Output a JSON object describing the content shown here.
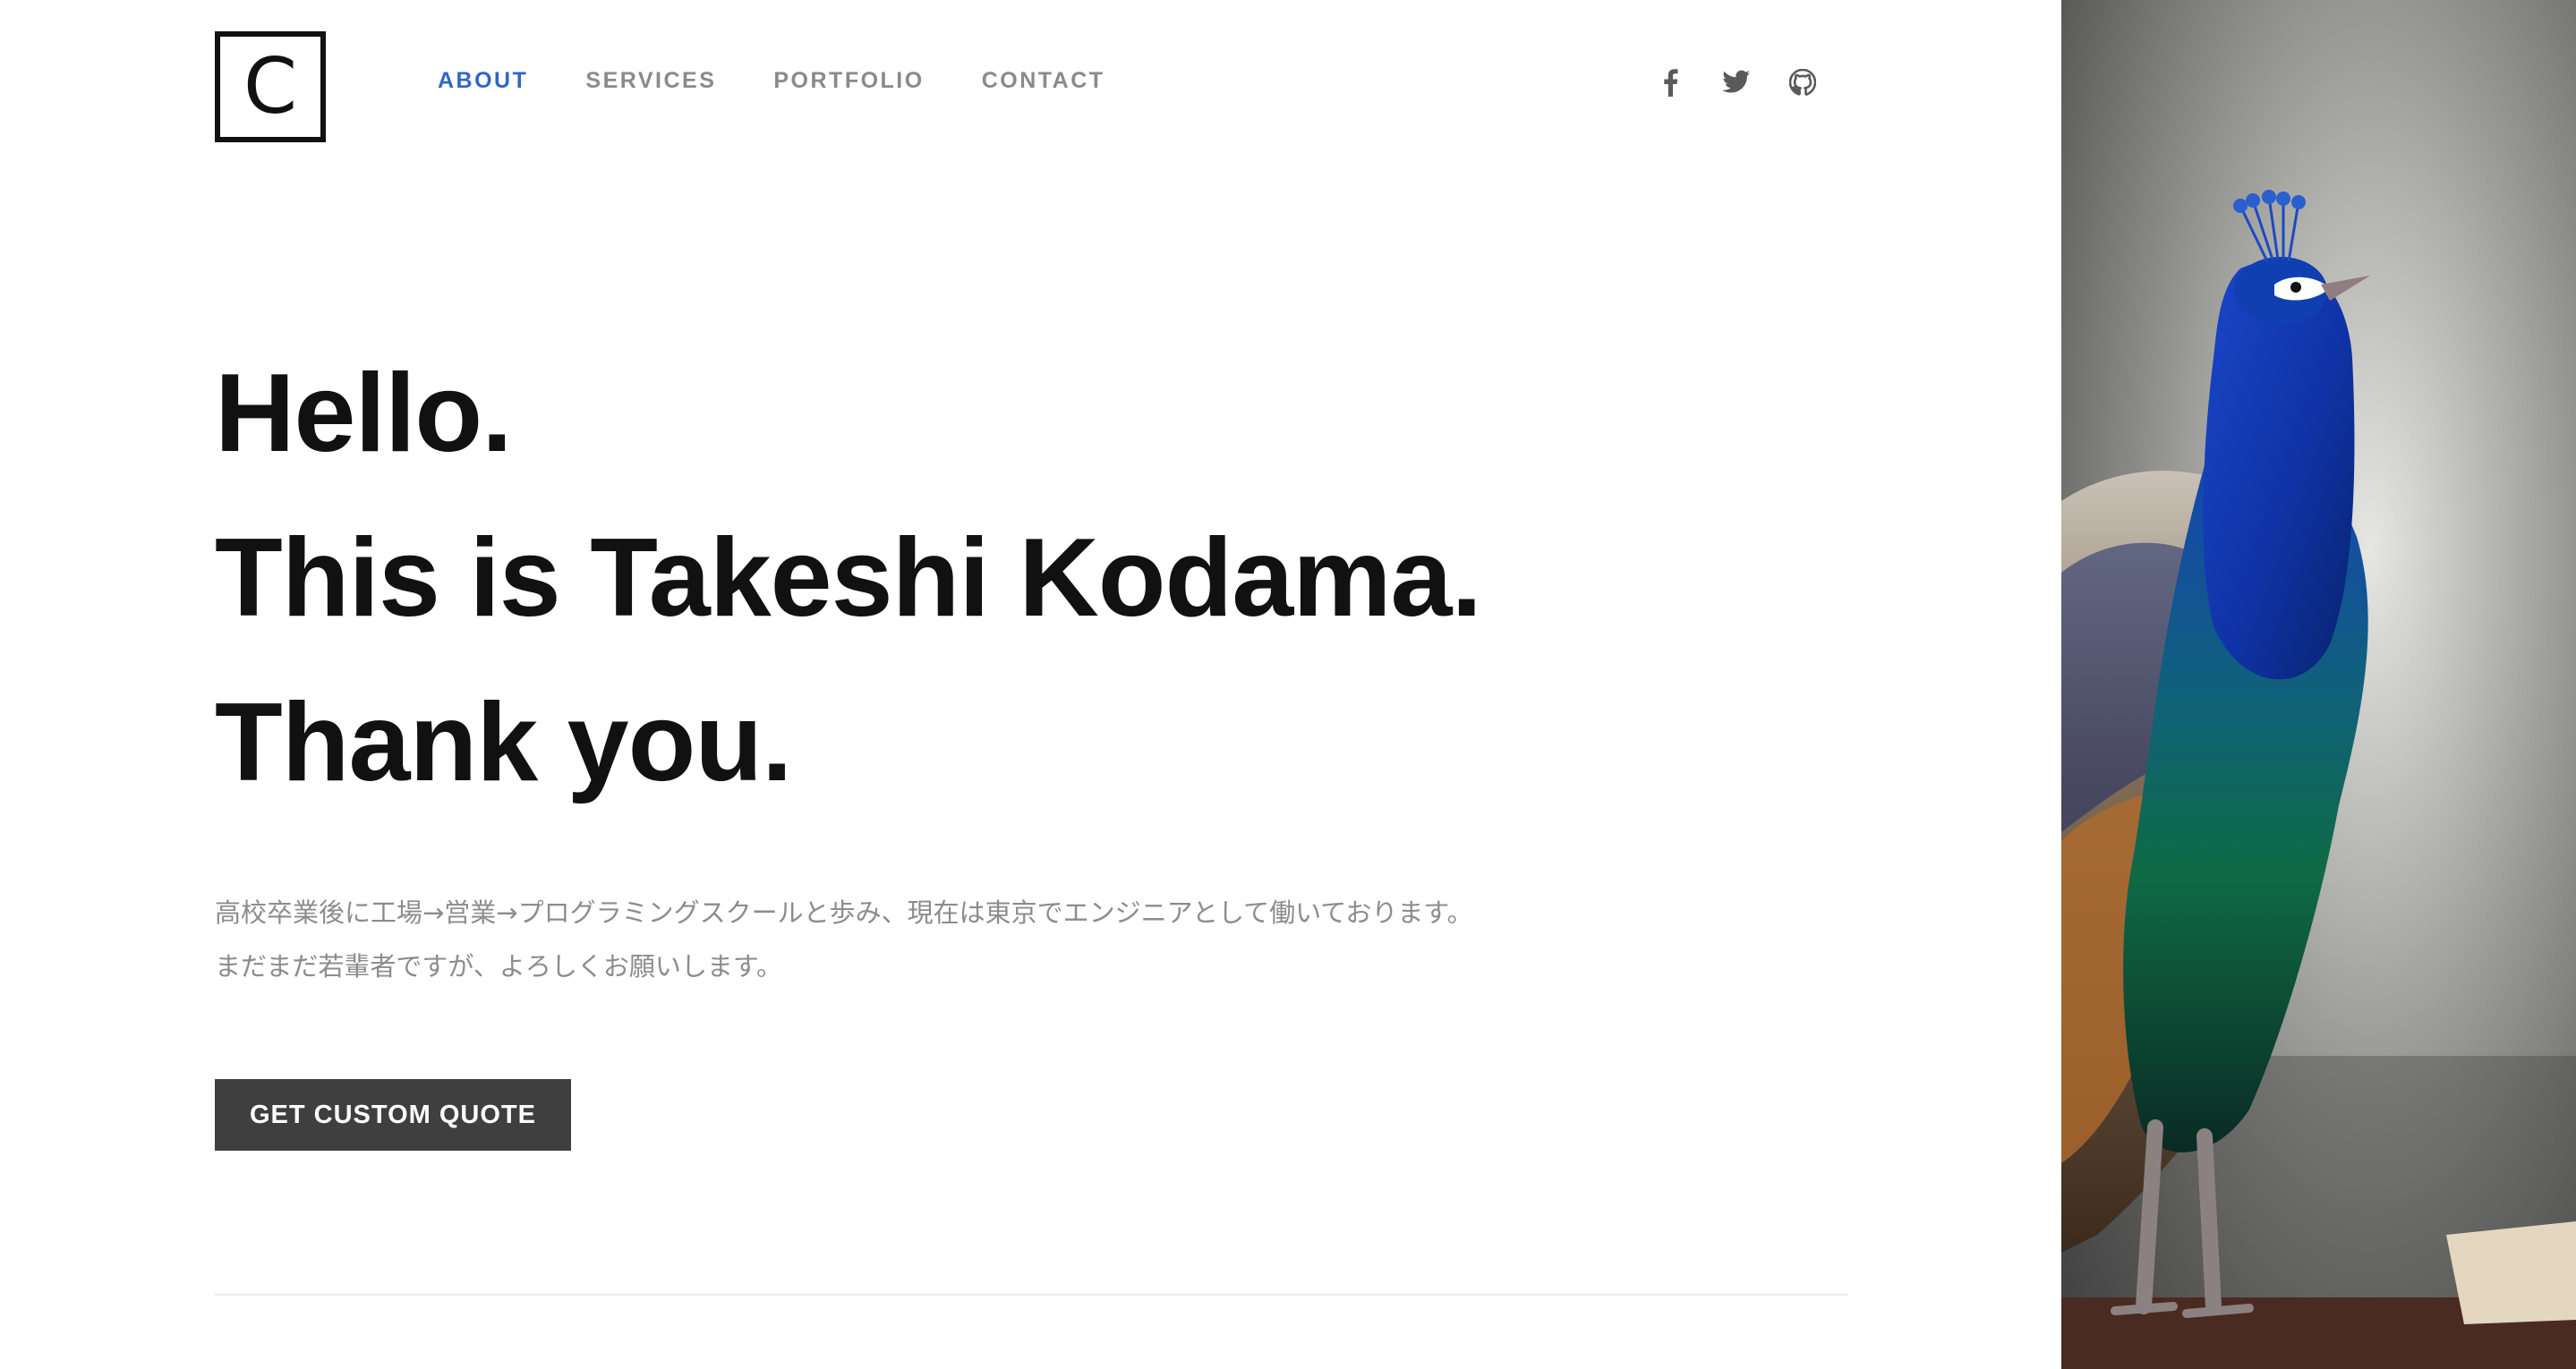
{
  "brand": {
    "logo_letter": "C"
  },
  "nav": {
    "items": [
      {
        "label": "ABOUT",
        "active": true
      },
      {
        "label": "SERVICES",
        "active": false
      },
      {
        "label": "PORTFOLIO",
        "active": false
      },
      {
        "label": "CONTACT",
        "active": false
      }
    ],
    "active_color": "#2f66c9"
  },
  "social": {
    "icons": [
      "facebook-icon",
      "twitter-icon",
      "github-icon"
    ]
  },
  "hero": {
    "line1": "Hello.",
    "line2": "This is Takeshi Kodama.",
    "line3": "Thank you.",
    "intro": "高校卒業後に工場→営業→プログラミングスクールと歩み、現在は東京でエンジニアとして働いております。まだまだ若輩者ですが、よろしくお願いします。",
    "cta_label": "GET CUSTOM QUOTE"
  },
  "hero_image": {
    "subject": "peacock-photo"
  }
}
